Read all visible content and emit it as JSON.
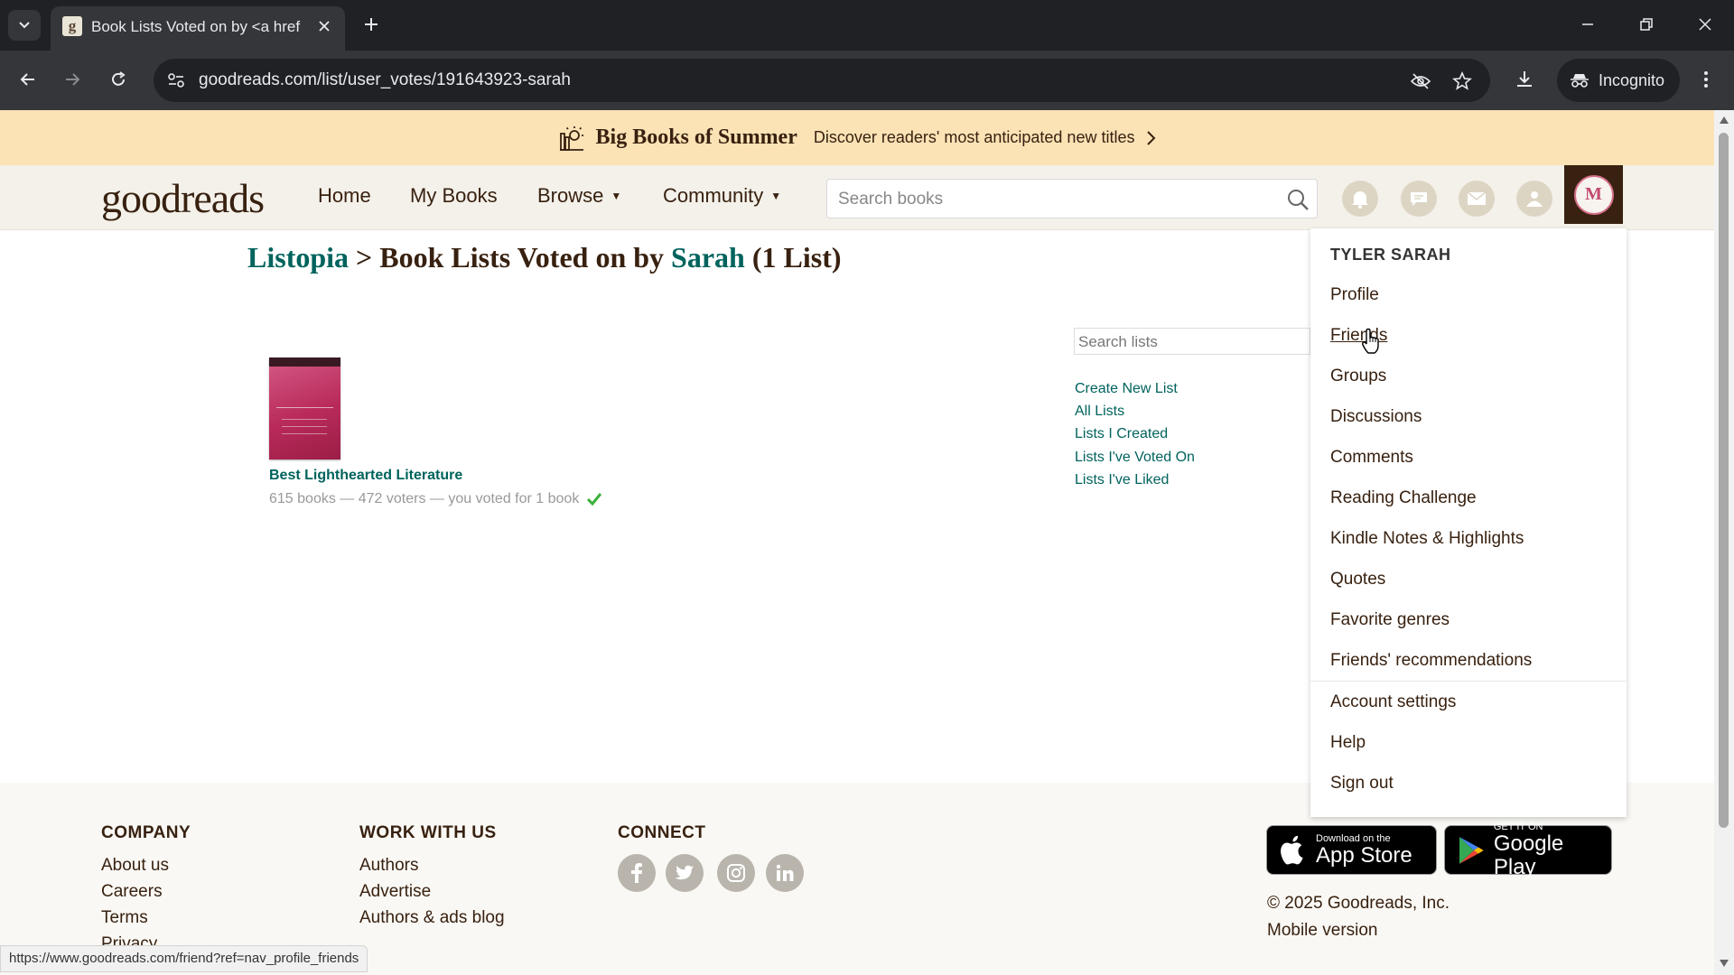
{
  "browser": {
    "tab_title": "Book Lists Voted on by <a href",
    "tab_favicon": "g",
    "url": "goodreads.com/list/user_votes/191643923-sarah",
    "incognito_label": "Incognito",
    "status_url": "https://www.goodreads.com/friend?ref=nav_profile_friends"
  },
  "promo": {
    "title": "Big Books of Summer",
    "text": "Discover readers' most anticipated new titles"
  },
  "header": {
    "logo": "goodreads",
    "nav": [
      "Home",
      "My Books",
      "Browse",
      "Community"
    ],
    "search_placeholder": "Search books",
    "avatar_initial": "M"
  },
  "page": {
    "title_link": "Listopia",
    "title_mid": " > Book Lists Voted on by ",
    "title_user": "Sarah",
    "title_count": " (1 List)"
  },
  "list": {
    "title": "Best Lighthearted Literature",
    "meta": "615 books — 472 voters — you voted for 1 book"
  },
  "sidebar": {
    "search_placeholder": "Search lists",
    "links": [
      "Create New List",
      "All Lists",
      "Lists I Created",
      "Lists I've Voted On",
      "Lists I've Liked"
    ]
  },
  "dropdown": {
    "name": "TYLER SARAH",
    "items": [
      "Profile",
      "Friends",
      "Groups",
      "Discussions",
      "Comments",
      "Reading Challenge",
      "Kindle Notes & Highlights",
      "Quotes",
      "Favorite genres",
      "Friends' recommendations"
    ],
    "account_items": [
      "Account settings",
      "Help",
      "Sign out"
    ]
  },
  "footer": {
    "company_heading": "COMPANY",
    "company_links": [
      "About us",
      "Careers",
      "Terms",
      "Privacy"
    ],
    "work_heading": "WORK WITH US",
    "work_links": [
      "Authors",
      "Advertise",
      "Authors & ads blog"
    ],
    "connect_heading": "CONNECT",
    "app_store_small": "Download on the",
    "app_store_big": "App Store",
    "google_play_small": "GET IT ON",
    "google_play_big": "Google Play",
    "copyright": "© 2025 Goodreads, Inc.",
    "mobile": "Mobile version"
  },
  "colors": {
    "brand_brown": "#382110",
    "link_green": "#00635d",
    "banner": "#fbe3b6",
    "header_bg": "#f4f1ea"
  }
}
